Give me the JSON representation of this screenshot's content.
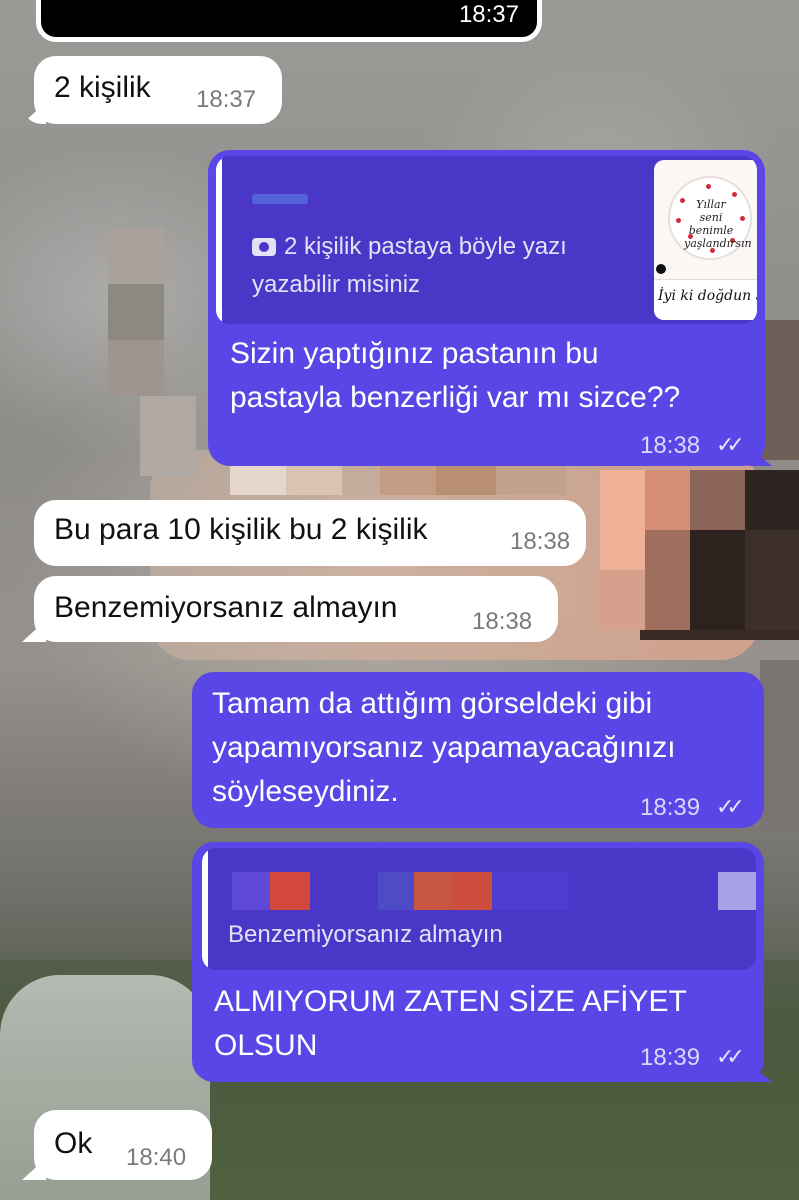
{
  "colors": {
    "outgoing": "#5a45e6",
    "incoming": "#ffffff",
    "quote_bg": "#4a37c8"
  },
  "top_message": {
    "time": "18:37"
  },
  "messages": [
    {
      "dir": "in",
      "text": "2 kişilik",
      "time": "18:37"
    },
    {
      "dir": "out",
      "reply_to": {
        "text": "2 kişilik pastaya böyle yazı\nyazabilir misiniz",
        "icon": "camera-icon",
        "thumb_text": {
          "cake": "Yıllar seni benimle yaşlandırsın",
          "card": "İyi ki doğdun Sevgilim"
        }
      },
      "text": "Sizin yaptığınız pastanın bu\npastayla benzerliği var mı sizce??",
      "time": "18:38",
      "status": "read"
    },
    {
      "dir": "in",
      "text": "Bu para 10 kişilik bu 2 kişilik",
      "time": "18:38"
    },
    {
      "dir": "in",
      "text": "Benzemiyorsanız almayın",
      "time": "18:38"
    },
    {
      "dir": "out",
      "text": "Tamam da attığım görseldeki gibi\nyapamıyorsanız yapamayacağınızı\nsöyleseydiniz.",
      "time": "18:39",
      "status": "read"
    },
    {
      "dir": "out",
      "reply_to": {
        "text": "Benzemiyorsanız almayın"
      },
      "text": "ALMIYORUM ZATEN SİZE AFİYET\nOLSUN",
      "time": "18:39",
      "status": "read"
    },
    {
      "dir": "in",
      "text": "Ok",
      "time": "18:40"
    }
  ]
}
